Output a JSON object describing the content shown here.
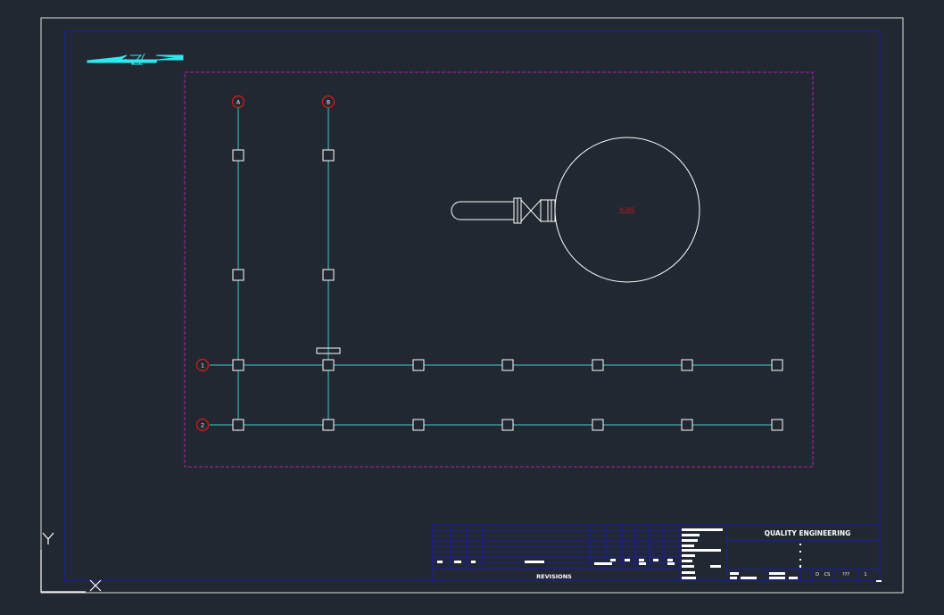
{
  "drawing": {
    "background": "#222831",
    "colors": {
      "sheet_border": "#e0e0e0",
      "inner_border": "#1a1aaa",
      "viewport": "#b020b0",
      "grid": "#40c8d0",
      "bubble": "#e01818",
      "equipment": "#ffffff",
      "tag": "#e01818",
      "title_block": "#1a1aaa",
      "text": "#ffffff",
      "north": "#30e8f0"
    },
    "grid_labels": {
      "col_a": "A",
      "col_b": "B",
      "row_1": "1",
      "row_2": "2"
    },
    "equipment_tag": "V-101",
    "ucs": {
      "x_label": "X",
      "y_label": "Y"
    },
    "title_block": {
      "company": "QUALITY ENGINEERING",
      "revisions_label": "REVISIONS",
      "size_code": "D",
      "cd": "CS",
      "dwg_no": "???",
      "sheet": "1"
    }
  }
}
